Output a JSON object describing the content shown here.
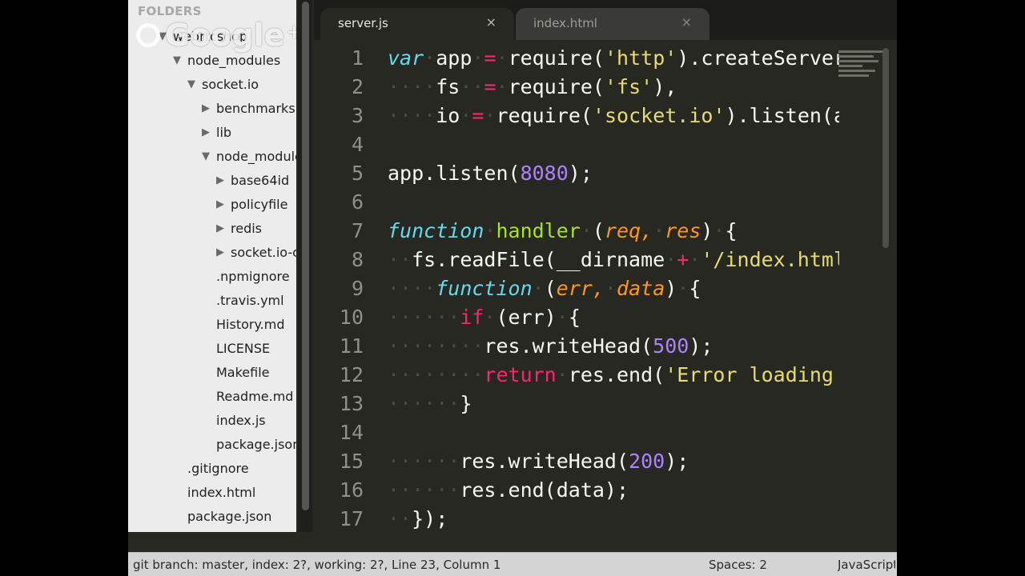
{
  "sidebar": {
    "header": "FOLDERS",
    "tree": [
      {
        "label": "webrtcshop",
        "arrow": "▼"
      },
      {
        "label": "node_modules",
        "arrow": "▼"
      },
      {
        "label": "socket.io",
        "arrow": "▼"
      },
      {
        "label": "benchmarks",
        "arrow": "▶"
      },
      {
        "label": "lib",
        "arrow": "▶"
      },
      {
        "label": "node_modules",
        "arrow": "▼"
      },
      {
        "label": "base64id",
        "arrow": "▶"
      },
      {
        "label": "policyfile",
        "arrow": "▶"
      },
      {
        "label": "redis",
        "arrow": "▶"
      },
      {
        "label": "socket.io-client",
        "arrow": "▶"
      },
      {
        "label": ".npmignore",
        "arrow": ""
      },
      {
        "label": ".travis.yml",
        "arrow": ""
      },
      {
        "label": "History.md",
        "arrow": ""
      },
      {
        "label": "LICENSE",
        "arrow": ""
      },
      {
        "label": "Makefile",
        "arrow": ""
      },
      {
        "label": "Readme.md",
        "arrow": ""
      },
      {
        "label": "index.js",
        "arrow": ""
      },
      {
        "label": "package.json",
        "arrow": ""
      },
      {
        "label": ".gitignore",
        "arrow": ""
      },
      {
        "label": "index.html",
        "arrow": ""
      },
      {
        "label": "package.json",
        "arrow": ""
      }
    ]
  },
  "overlay": {
    "brand": "Google",
    "plus": "+"
  },
  "tabs": [
    {
      "label": "server.js",
      "close": "×",
      "active": true
    },
    {
      "label": "index.html",
      "close": "×",
      "active": false
    }
  ],
  "editor": {
    "line_numbers": [
      "1",
      "2",
      "3",
      "4",
      "5",
      "6",
      "7",
      "8",
      "9",
      "10",
      "11",
      "12",
      "13",
      "14",
      "15",
      "16",
      "17"
    ],
    "lines": [
      [
        [
          "k-stor",
          "var"
        ],
        [
          "ws",
          "·"
        ],
        [
          "plain",
          "app"
        ],
        [
          "ws",
          "·"
        ],
        [
          "k-op",
          "="
        ],
        [
          "ws",
          "·"
        ],
        [
          "plain",
          "require("
        ],
        [
          "str",
          "'http'"
        ],
        [
          "plain",
          ").createServer(handler),"
        ]
      ],
      [
        [
          "ws",
          "····"
        ],
        [
          "plain",
          "fs"
        ],
        [
          "ws",
          "··"
        ],
        [
          "k-op",
          "="
        ],
        [
          "ws",
          "·"
        ],
        [
          "plain",
          "require("
        ],
        [
          "str",
          "'fs'"
        ],
        [
          "plain",
          "),"
        ]
      ],
      [
        [
          "ws",
          "····"
        ],
        [
          "plain",
          "io"
        ],
        [
          "ws",
          "·"
        ],
        [
          "k-op",
          "="
        ],
        [
          "ws",
          "·"
        ],
        [
          "plain",
          "require("
        ],
        [
          "str",
          "'socket.io'"
        ],
        [
          "plain",
          ").listen(app);"
        ]
      ],
      [],
      [
        [
          "plain",
          "app.listen("
        ],
        [
          "num",
          "8080"
        ],
        [
          "plain",
          ");"
        ]
      ],
      [],
      [
        [
          "k-stor",
          "function"
        ],
        [
          "ws",
          "·"
        ],
        [
          "fn",
          "handler"
        ],
        [
          "ws",
          "·"
        ],
        [
          "plain",
          "("
        ],
        [
          "param",
          "req,"
        ],
        [
          "ws",
          "·"
        ],
        [
          "param",
          "res"
        ],
        [
          "plain",
          ")"
        ],
        [
          "ws",
          "·"
        ],
        [
          "plain",
          "{"
        ]
      ],
      [
        [
          "ws",
          "··"
        ],
        [
          "plain",
          "fs.readFile(__dirname"
        ],
        [
          "ws",
          "·"
        ],
        [
          "k-op",
          "+"
        ],
        [
          "ws",
          "·"
        ],
        [
          "str",
          "'/index.html',"
        ]
      ],
      [
        [
          "ws",
          "····"
        ],
        [
          "k-stor",
          "function"
        ],
        [
          "ws",
          "·"
        ],
        [
          "plain",
          "("
        ],
        [
          "param",
          "err,"
        ],
        [
          "ws",
          "·"
        ],
        [
          "param",
          "data"
        ],
        [
          "plain",
          ")"
        ],
        [
          "ws",
          "·"
        ],
        [
          "plain",
          "{"
        ]
      ],
      [
        [
          "ws",
          "······"
        ],
        [
          "k-ctrl",
          "if"
        ],
        [
          "ws",
          "·"
        ],
        [
          "plain",
          "(err)"
        ],
        [
          "ws",
          "·"
        ],
        [
          "plain",
          "{"
        ]
      ],
      [
        [
          "ws",
          "········"
        ],
        [
          "plain",
          "res.writeHead("
        ],
        [
          "num",
          "500"
        ],
        [
          "plain",
          ");"
        ]
      ],
      [
        [
          "ws",
          "········"
        ],
        [
          "k-ctrl",
          "return"
        ],
        [
          "ws",
          "·"
        ],
        [
          "plain",
          "res.end("
        ],
        [
          "str",
          "'Error loading index.html'"
        ],
        [
          "plain",
          ");"
        ]
      ],
      [
        [
          "ws",
          "······"
        ],
        [
          "plain",
          "}"
        ]
      ],
      [],
      [
        [
          "ws",
          "······"
        ],
        [
          "plain",
          "res.writeHead("
        ],
        [
          "num",
          "200"
        ],
        [
          "plain",
          ");"
        ]
      ],
      [
        [
          "ws",
          "······"
        ],
        [
          "plain",
          "res.end(data);"
        ]
      ],
      [
        [
          "ws",
          "··"
        ],
        [
          "plain",
          "});"
        ]
      ]
    ]
  },
  "status_bar": {
    "git": "git branch: master, index: 2?, working: 2?, Line 23, Column 1",
    "spaces": "Spaces: 2",
    "syntax": "JavaScript"
  }
}
